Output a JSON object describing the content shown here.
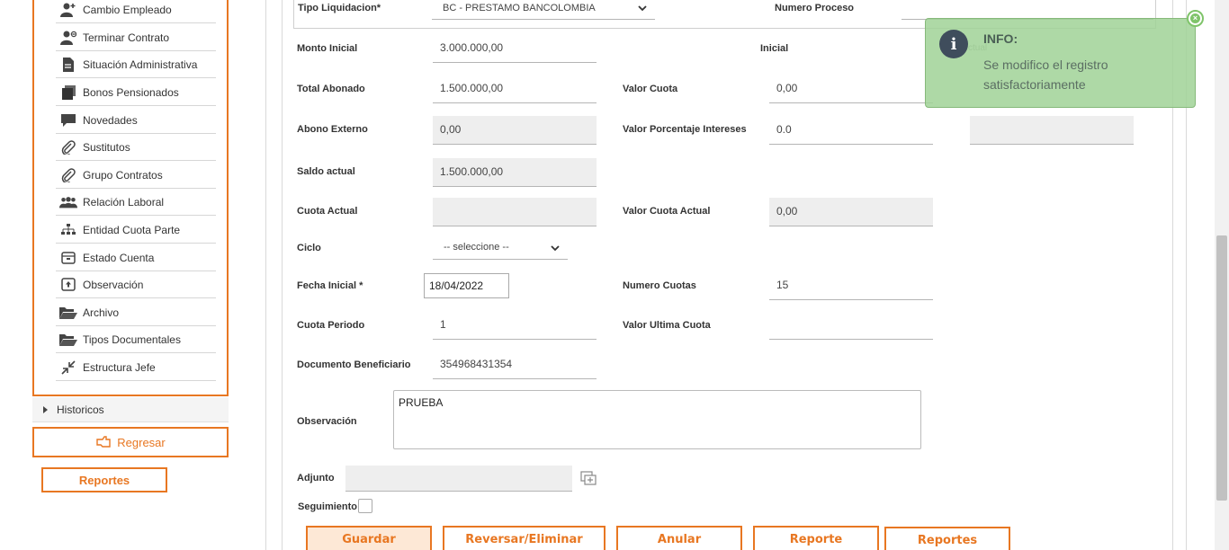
{
  "sidebar": {
    "items": [
      {
        "label": "Cambio Empleado",
        "icon": "user-plus-icon"
      },
      {
        "label": "Terminar Contrato",
        "icon": "user-minus-icon"
      },
      {
        "label": "Situación Administrativa",
        "icon": "document-icon"
      },
      {
        "label": "Bonos Pensionados",
        "icon": "stack-icon"
      },
      {
        "label": "Novedades",
        "icon": "chat-icon"
      },
      {
        "label": "Sustitutos",
        "icon": "paperclip-icon"
      },
      {
        "label": "Grupo Contratos",
        "icon": "paperclip-icon"
      },
      {
        "label": "Relación Laboral",
        "icon": "users-icon"
      },
      {
        "label": "Entidad Cuota Parte",
        "icon": "org-icon"
      },
      {
        "label": "Estado Cuenta",
        "icon": "folder-box-icon"
      },
      {
        "label": "Observación",
        "icon": "upload-box-icon"
      },
      {
        "label": "Archivo",
        "icon": "folder-open-icon"
      },
      {
        "label": "Tipos Documentales",
        "icon": "folder-open-icon"
      },
      {
        "label": "Estructura Jefe",
        "icon": "compress-icon"
      }
    ],
    "historicos_label": "Historicos",
    "regresar_label": "Regresar",
    "reportes_label": "Reportes"
  },
  "form": {
    "tipo_liquidacion": {
      "label": "Tipo Liquidacion*",
      "value": "BC - PRESTAMO BANCOLOMBIA"
    },
    "numero_proceso": {
      "label": "Numero Proceso"
    },
    "monto_inicial": {
      "label": "Monto Inicial",
      "value": "3.000.000,00"
    },
    "inicial": {
      "label": "Inicial"
    },
    "actual_partial": "ctual",
    "total_abonado": {
      "label": "Total Abonado",
      "value": "1.500.000,00"
    },
    "valor_cuota": {
      "label": "Valor Cuota",
      "value": "0,00"
    },
    "abono_externo": {
      "label": "Abono Externo",
      "value": "0,00"
    },
    "valor_porcentaje_intereses": {
      "label": "Valor Porcentaje Intereses",
      "value": "0.0"
    },
    "saldo_actual": {
      "label": "Saldo actual",
      "value": "1.500.000,00"
    },
    "cuota_actual": {
      "label": "Cuota Actual",
      "value": ""
    },
    "valor_cuota_actual": {
      "label": "Valor Cuota Actual",
      "value": "0,00"
    },
    "ciclo": {
      "label": "Ciclo",
      "value": "-- seleccione --"
    },
    "fecha_inicial": {
      "label": "Fecha Inicial *",
      "value": "18/04/2022"
    },
    "numero_cuotas": {
      "label": "Numero Cuotas",
      "value": "15"
    },
    "cuota_periodo": {
      "label": "Cuota Periodo",
      "value": "1"
    },
    "valor_ultima_cuota": {
      "label": "Valor Ultima Cuota",
      "value": ""
    },
    "documento_beneficiario": {
      "label": "Documento Beneficiario",
      "value": "354968431354"
    },
    "observacion": {
      "label": "Observación",
      "value": "PRUEBA"
    },
    "adjunto": {
      "label": "Adjunto"
    },
    "seguimiento": {
      "label": "Seguimiento",
      "checked": false
    }
  },
  "buttons": {
    "guardar": "Guardar",
    "reversar": "Reversar/Eliminar",
    "anular": "Anular",
    "reporte": "Reporte",
    "reportes": "Reportes"
  },
  "toast": {
    "title": "INFO:",
    "message": "Se modifico el registro satisfactoriamente",
    "icon": "info-icon"
  },
  "colors": {
    "accent": "#e87722",
    "toast_bg": "#a0d296",
    "readonly_bg": "#eeeeee"
  }
}
